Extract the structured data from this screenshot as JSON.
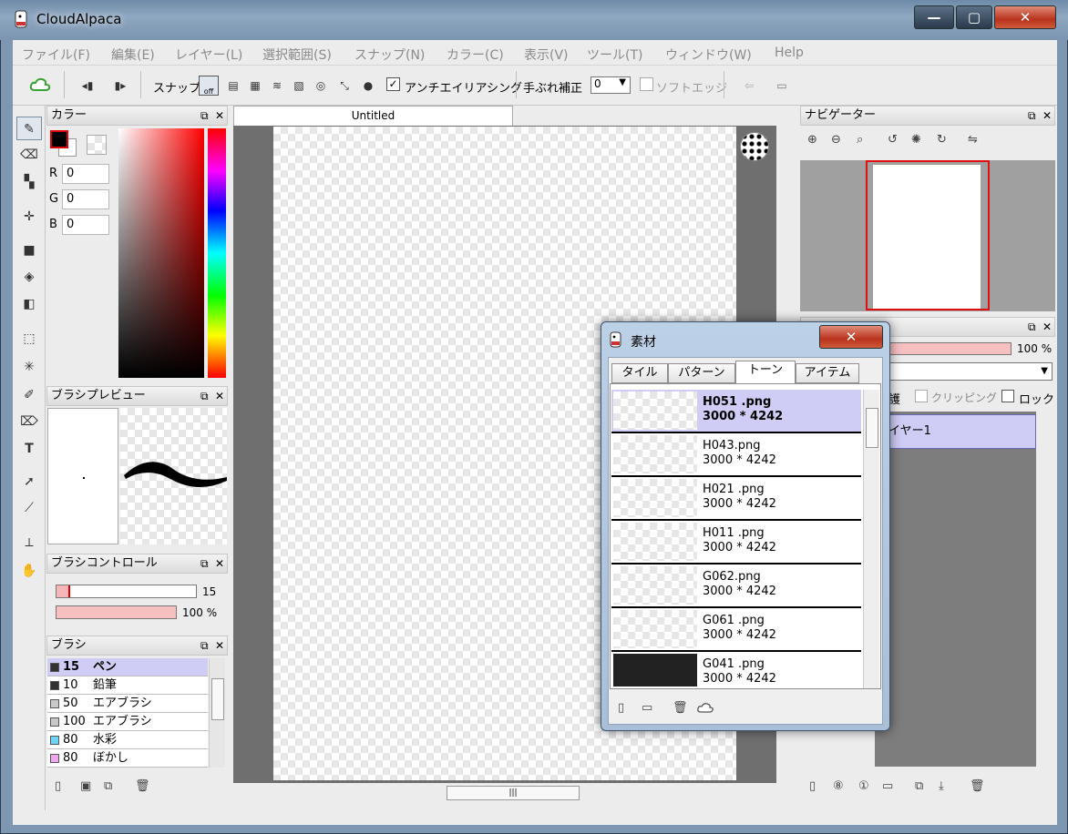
{
  "window": {
    "title": "CloudAlpaca",
    "minimize": "—",
    "maximize": "▢",
    "close": "✕"
  },
  "menu": [
    "ファイル(F)",
    "編集(E)",
    "レイヤー(L)",
    "選択範囲(S)",
    "スナップ(N)",
    "カラー(C)",
    "表示(V)",
    "ツール(T)",
    "ウィンドウ(W)",
    "Help"
  ],
  "toolbar": {
    "snap_label": "スナップ",
    "snap_off": "off",
    "antialias_label": "アンチエイリアシング",
    "antialias_checked": "✓",
    "stabilizer_label": "手ぶれ補正",
    "stabilizer_value": "0",
    "soft_edge_label": "ソフトエッジ"
  },
  "color_panel": {
    "title": "カラー",
    "r_label": "R",
    "g_label": "G",
    "b_label": "B",
    "r": "0",
    "g": "0",
    "b": "0",
    "foreground": "#000000"
  },
  "brush_preview": {
    "title": "ブラシプレビュー"
  },
  "brush_control": {
    "title": "ブラシコントロール",
    "size": "15",
    "opacity": "100 %"
  },
  "brush_panel": {
    "title": "ブラシ",
    "items": [
      {
        "size": "15",
        "name": "ペン",
        "color": "#333333"
      },
      {
        "size": "10",
        "name": "鉛筆",
        "color": "#333333"
      },
      {
        "size": "50",
        "name": "エアブラシ",
        "color": "#c8c8c8"
      },
      {
        "size": "100",
        "name": "エアブラシ",
        "color": "#c8c8c8"
      },
      {
        "size": "80",
        "name": "水彩",
        "color": "#6fd3f5"
      },
      {
        "size": "80",
        "name": "ぼかし",
        "color": "#f0a8f0"
      }
    ]
  },
  "canvas": {
    "tab": "Untitled"
  },
  "navigator": {
    "title": "ナビゲーター"
  },
  "layer_panel": {
    "opacity": "100 %",
    "protect_label": "護",
    "clipping_label": "クリッピング",
    "lock_label": "ロック",
    "layer_name": "イヤー1"
  },
  "material_dialog": {
    "title": "素材",
    "tabs": [
      "タイル",
      "パターン",
      "トーン",
      "アイテム"
    ],
    "items": [
      {
        "name": "H051 .png",
        "size": "3000 * 4242"
      },
      {
        "name": "H043.png",
        "size": "3000 * 4242"
      },
      {
        "name": "H021 .png",
        "size": "3000 * 4242"
      },
      {
        "name": "H011 .png",
        "size": "3000 * 4242"
      },
      {
        "name": "G062.png",
        "size": "3000 * 4242"
      },
      {
        "name": "G061 .png",
        "size": "3000 * 4242"
      },
      {
        "name": "G041 .png",
        "size": "3000 * 4242"
      }
    ]
  }
}
